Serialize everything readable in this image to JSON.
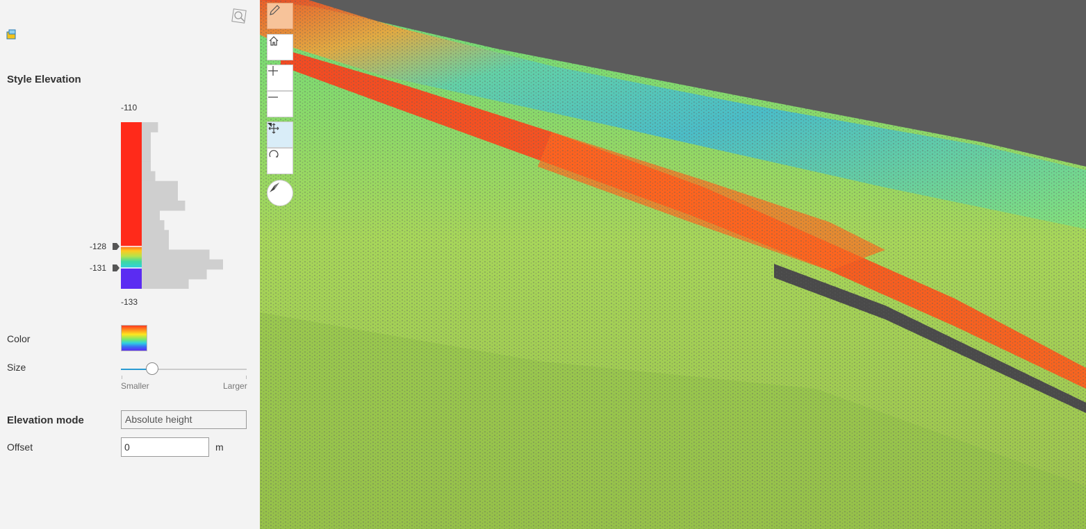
{
  "panel": {
    "title": "Style Elevation",
    "histogram": {
      "max_label": "-110",
      "min_label": "-133",
      "stop_upper_label": "-128",
      "stop_lower_label": "-131",
      "bins": [
        0.18,
        0.1,
        0.1,
        0.1,
        0.1,
        0.15,
        0.4,
        0.4,
        0.48,
        0.2,
        0.25,
        0.3,
        0.3,
        0.75,
        0.9,
        0.72,
        0.52
      ]
    },
    "color": {
      "label": "Color"
    },
    "size": {
      "label": "Size",
      "min_label": "Smaller",
      "max_label": "Larger",
      "value_fraction": 0.25
    },
    "elevation_mode": {
      "label": "Elevation mode",
      "value": "Absolute height"
    },
    "offset": {
      "label": "Offset",
      "value": "0",
      "unit": "m"
    }
  },
  "scene": {
    "tools": [
      "pencil-icon",
      "home-icon",
      "plus-icon",
      "minus-icon",
      "pan-icon",
      "rotate-icon",
      "compass-icon"
    ]
  },
  "colors": {
    "ramp_top": "#ff3b1f",
    "ramp_bottom": "#5b2cf2",
    "scene_background": "#5c5c5c",
    "accent": "#2a9bd3"
  }
}
